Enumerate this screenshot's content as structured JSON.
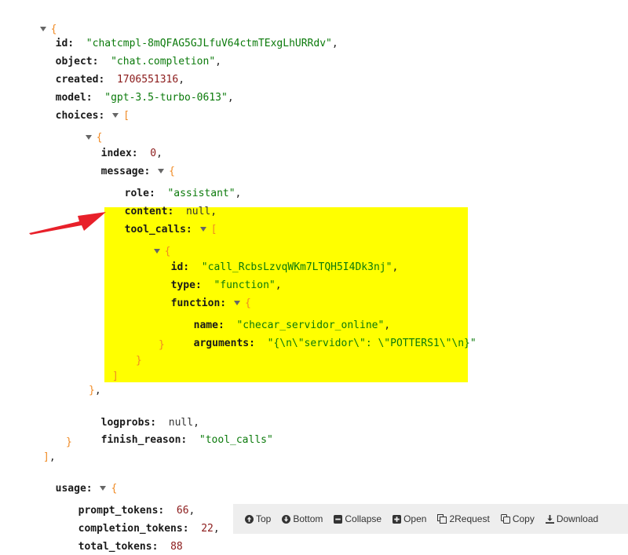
{
  "json": {
    "id": "\"chatcmpl-8mQFAG5GJLfuV64ctmTExgLhURRdv\"",
    "object": "\"chat.completion\"",
    "created": "1706551316",
    "model": "\"gpt-3.5-turbo-0613\"",
    "index": "0",
    "role": "\"assistant\"",
    "content": "null",
    "tool_call_id": "\"call_RcbsLzvqWKm7LTQH5I4Dk3nj\"",
    "tool_call_type": "\"function\"",
    "function_name": "\"checar_servidor_online\"",
    "function_arguments": "\"{\\n\\\"servidor\\\": \\\"POTTERS1\\\"\\n}\"",
    "logprobs": "null",
    "finish_reason": "\"tool_calls\"",
    "prompt_tokens": "66",
    "completion_tokens": "22",
    "total_tokens": "88"
  },
  "keys": {
    "id": "id:",
    "object": "object:",
    "created": "created:",
    "model": "model:",
    "choices": "choices:",
    "index": "index:",
    "message": "message:",
    "role": "role:",
    "content": "content:",
    "tool_calls": "tool_calls:",
    "type": "type:",
    "function": "function:",
    "name": "name:",
    "arguments": "arguments:",
    "logprobs": "logprobs:",
    "finish_reason": "finish_reason:",
    "usage": "usage:",
    "prompt_tokens": "prompt_tokens:",
    "completion_tokens": "completion_tokens:",
    "total_tokens": "total_tokens:"
  },
  "toolbar": {
    "top": "Top",
    "bottom": "Bottom",
    "collapse": "Collapse",
    "open": "Open",
    "request": "2Request",
    "copy": "Copy",
    "download": "Download"
  },
  "colors": {
    "highlight": "#ffff00",
    "arrow": "#e8202a",
    "string": "#0b7a0b",
    "number": "#8b1a1a",
    "bracket": "#f08a24"
  }
}
